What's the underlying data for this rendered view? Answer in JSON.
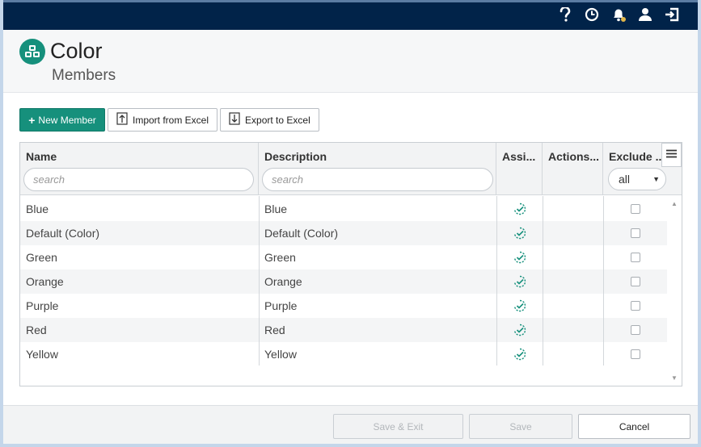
{
  "topbar": {
    "icons": [
      "help-icon",
      "history-clock-icon",
      "notifications-bell-icon",
      "user-icon",
      "logout-icon"
    ]
  },
  "header": {
    "title": "Color",
    "subtitle": "Members",
    "logo_icon": "dimension-cubes-icon"
  },
  "toolbar": {
    "new_member_label": "New Member",
    "import_label": "Import from Excel",
    "export_label": "Export to Excel"
  },
  "grid": {
    "columns": {
      "name": "Name",
      "description": "Description",
      "assigned": "Assi...",
      "actions": "Actions...",
      "exclude": "Exclude ..."
    },
    "name_search_placeholder": "search",
    "description_search_placeholder": "search",
    "exclude_filter_value": "all",
    "rows": [
      {
        "name": "Blue",
        "description": "Blue",
        "assigned": true,
        "exclude": false
      },
      {
        "name": "Default (Color)",
        "description": "Default (Color)",
        "assigned": true,
        "exclude": false
      },
      {
        "name": "Green",
        "description": "Green",
        "assigned": true,
        "exclude": false
      },
      {
        "name": "Orange",
        "description": "Orange",
        "assigned": true,
        "exclude": false
      },
      {
        "name": "Purple",
        "description": "Purple",
        "assigned": true,
        "exclude": false
      },
      {
        "name": "Red",
        "description": "Red",
        "assigned": true,
        "exclude": false
      },
      {
        "name": "Yellow",
        "description": "Yellow",
        "assigned": true,
        "exclude": false
      }
    ]
  },
  "footer": {
    "save_exit_label": "Save & Exit",
    "save_label": "Save",
    "cancel_label": "Cancel"
  },
  "colors": {
    "topbar": "#012349",
    "accent": "#16907c"
  }
}
